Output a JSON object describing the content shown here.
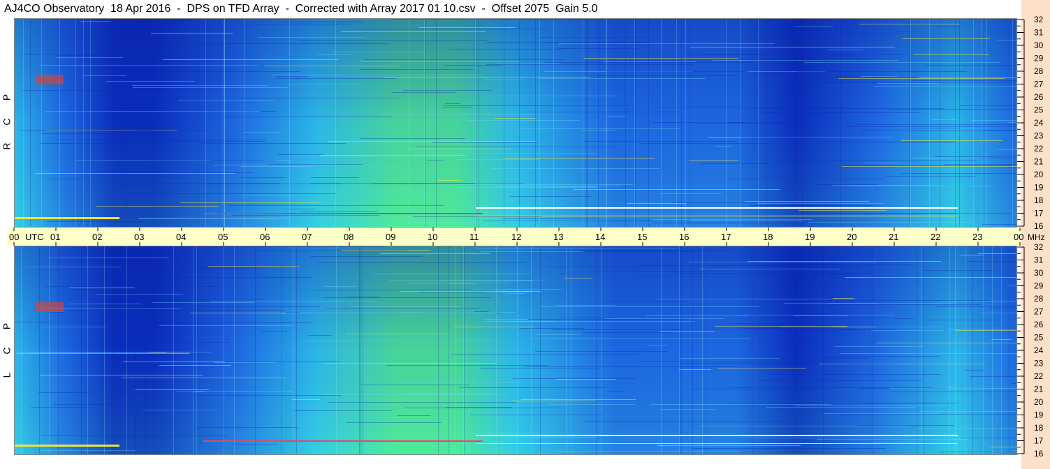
{
  "title": "AJ4CO Observatory  18 Apr 2016  -  DPS on TFD Array  -  Corrected with Array 2017 01 10.csv  -  Offset 2075  Gain 5.0",
  "colors": {
    "band": "#ffffc8",
    "right_strip": "#fde0c8",
    "deep_blue": "#0a2fbf",
    "mid_blue": "#1f6fe8",
    "cyan": "#2fc6f0",
    "green": "#4ee89a",
    "yellow": "#f4e23a",
    "red": "#e8412a"
  },
  "chart_data": [
    {
      "type": "heatmap",
      "panel": "RCP",
      "polarization_label": [
        "R",
        "C",
        "P"
      ],
      "x_axis": {
        "label": "UTC",
        "ticks": [
          "00",
          "01",
          "02",
          "03",
          "04",
          "05",
          "06",
          "07",
          "08",
          "09",
          "10",
          "11",
          "12",
          "13",
          "14",
          "15",
          "16",
          "17",
          "18",
          "19",
          "20",
          "21",
          "22",
          "23",
          "00"
        ],
        "range": [
          0,
          24
        ]
      },
      "y_axis": {
        "unit": "MHz",
        "ticks": [
          "32",
          "31",
          "30",
          "29",
          "28",
          "27",
          "26",
          "25",
          "24",
          "23",
          "22",
          "21",
          "20",
          "19",
          "18",
          "17",
          "16"
        ],
        "range": [
          16,
          32
        ]
      },
      "colormap": [
        "#0a2fbf",
        "#1f6fe8",
        "#2fc6f0",
        "#4ee89a",
        "#f4e23a",
        "#e8412a"
      ]
    },
    {
      "type": "heatmap",
      "panel": "LCP",
      "polarization_label": [
        "L",
        "C",
        "P"
      ],
      "x_axis": {
        "label": "UTC",
        "ticks": [
          "00",
          "01",
          "02",
          "03",
          "04",
          "05",
          "06",
          "07",
          "08",
          "09",
          "10",
          "11",
          "12",
          "13",
          "14",
          "15",
          "16",
          "17",
          "18",
          "19",
          "20",
          "21",
          "22",
          "23",
          "00"
        ],
        "range": [
          0,
          24
        ]
      },
      "y_axis": {
        "unit": "MHz",
        "ticks": [
          "32",
          "31",
          "30",
          "29",
          "28",
          "27",
          "26",
          "25",
          "24",
          "23",
          "22",
          "21",
          "20",
          "19",
          "18",
          "17",
          "16"
        ],
        "range": [
          16,
          32
        ]
      },
      "colormap": [
        "#0a2fbf",
        "#1f6fe8",
        "#2fc6f0",
        "#4ee89a",
        "#f4e23a",
        "#e8412a"
      ]
    }
  ],
  "axis_labels": {
    "utc": "UTC",
    "mhz": "MHz"
  }
}
